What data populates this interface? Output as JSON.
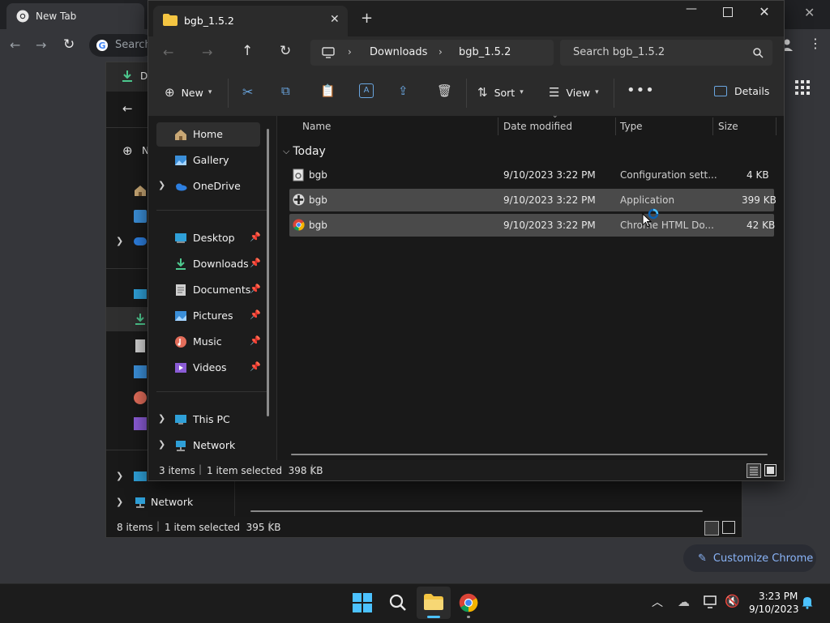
{
  "chrome": {
    "tab_title": "New Tab",
    "omnibox_placeholder": "Search",
    "customize_label": "Customize Chrome"
  },
  "bg_explorer": {
    "partial_tab_letter": "D",
    "partial_new_letter": "N",
    "network_label": "Network",
    "status_items": "8 items",
    "status_selected": "1 item selected  395 KB"
  },
  "explorer": {
    "tab_title": "bgb_1.5.2",
    "breadcrumb": [
      "Downloads",
      "bgb_1.5.2"
    ],
    "search_placeholder": "Search bgb_1.5.2",
    "commands": {
      "new": "New",
      "sort": "Sort",
      "view": "View",
      "details": "Details"
    },
    "nav": [
      {
        "label": "Home",
        "icon": "home-icon",
        "selected": true
      },
      {
        "label": "Gallery",
        "icon": "gallery-icon"
      },
      {
        "label": "OneDrive",
        "icon": "onedrive-icon",
        "expandable": true
      },
      {
        "label": "Desktop",
        "icon": "desktop-icon",
        "pinned": true
      },
      {
        "label": "Downloads",
        "icon": "downloads-icon",
        "pinned": true
      },
      {
        "label": "Documents",
        "icon": "documents-icon",
        "pinned": true
      },
      {
        "label": "Pictures",
        "icon": "pictures-icon",
        "pinned": true
      },
      {
        "label": "Music",
        "icon": "music-icon",
        "pinned": true
      },
      {
        "label": "Videos",
        "icon": "videos-icon",
        "pinned": true
      },
      {
        "label": "This PC",
        "icon": "this-pc-icon",
        "expandable": true
      },
      {
        "label": "Network",
        "icon": "network-icon",
        "expandable": true
      }
    ],
    "columns": [
      "Name",
      "Date modified",
      "Type",
      "Size"
    ],
    "group": "Today",
    "files": [
      {
        "name": "bgb",
        "date": "9/10/2023 3:22 PM",
        "type": "Configuration sett...",
        "size": "4 KB",
        "icon": "config-file-icon"
      },
      {
        "name": "bgb",
        "date": "9/10/2023 3:22 PM",
        "type": "Application",
        "size": "399 KB",
        "icon": "application-icon",
        "selected": true
      },
      {
        "name": "bgb",
        "date": "9/10/2023 3:22 PM",
        "type": "Chrome HTML Do...",
        "size": "42 KB",
        "icon": "chrome-html-icon",
        "selected": true
      }
    ],
    "status": {
      "items": "3 items",
      "selected": "1 item selected  398 KB"
    }
  },
  "taskbar": {
    "time": "3:23 PM",
    "date": "9/10/2023"
  },
  "colors": {
    "accent": "#4cc2ff",
    "selection": "#4a4a4a",
    "folder": "#f4c542"
  }
}
